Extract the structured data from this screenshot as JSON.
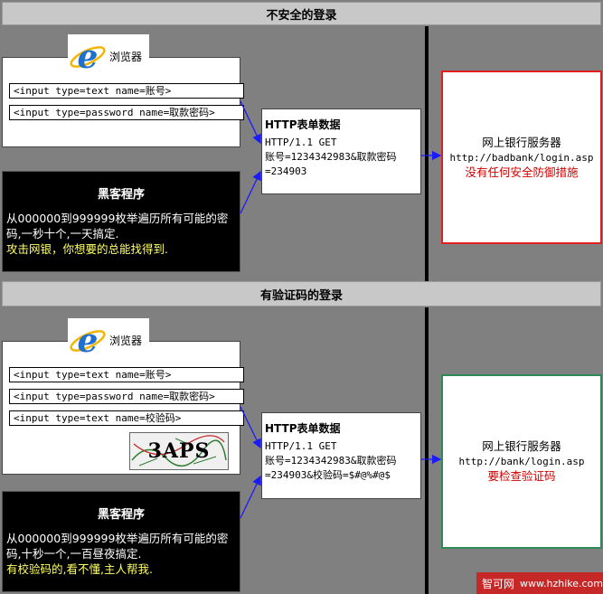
{
  "top": {
    "header": "不安全的登录",
    "browser_label": "浏览器",
    "fields": [
      "<input type=text name=账号>",
      "<input type=password name=取款密码>"
    ],
    "hacker": {
      "title": "黑客程序",
      "text": "从000000到999999枚举遍历所有可能的密码,一秒十个,一天搞定.",
      "highlight": "攻击网银，你想要的总能找得到."
    },
    "http": {
      "title": "HTTP表单数据",
      "line1": "HTTP/1.1 GET",
      "line2": "账号=1234342983&取款密码=234903"
    },
    "server": {
      "title": "网上银行服务器",
      "url": "http://badbank/login.asp",
      "note": "没有任何安全防御措施"
    }
  },
  "bottom": {
    "header": "有验证码的登录",
    "browser_label": "浏览器",
    "fields": [
      "<input type=text name=账号>",
      "<input type=password name=取款密码>",
      "<input type=text name=校验码>"
    ],
    "captcha_text": "3APS",
    "hacker": {
      "title": "黑客程序",
      "text": "从000000到999999枚举遍历所有可能的密码,十秒一个,一百昼夜搞定.",
      "highlight": "有校验码的,看不懂,主人帮我."
    },
    "http": {
      "title": "HTTP表单数据",
      "line1": "HTTP/1.1 GET",
      "line2": "账号=1234342983&取款密码=234903&校验码=$#@%#@$"
    },
    "server": {
      "title": "网上银行服务器",
      "url": "http://bank/login.asp",
      "note": "要检查验证码"
    }
  },
  "watermark": {
    "site": "智可网",
    "url": "www.hzhike.com"
  },
  "colors": {
    "background": "#808080",
    "header": "#c8c8c8",
    "arrow": "#1a1aff",
    "insecure_border": "#e02020",
    "secure_border": "#2e8b57",
    "warning_text": "#d00000",
    "hacker_highlight": "#ffff66"
  }
}
